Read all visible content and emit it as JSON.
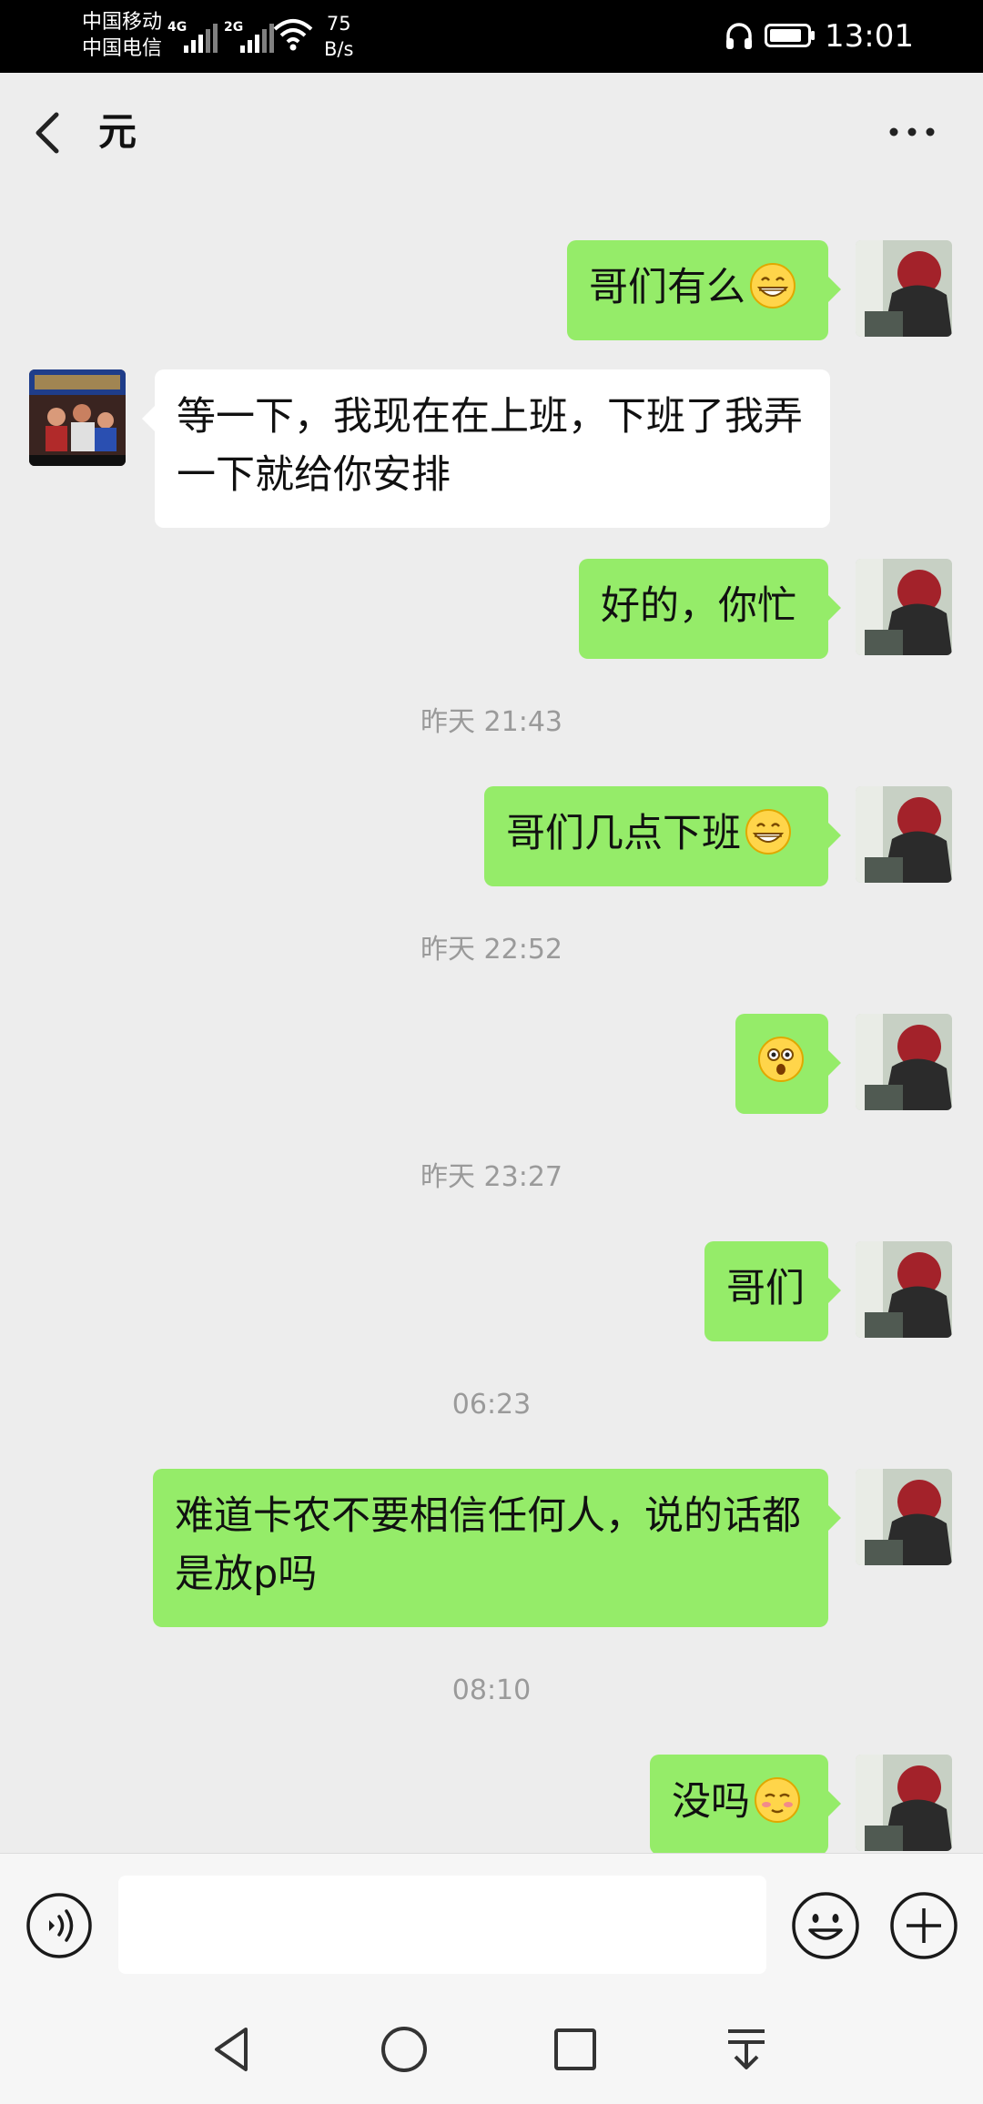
{
  "status_bar": {
    "carrier_1": "中国移动",
    "carrier_2": "中国电信",
    "network_1": "4G",
    "network_2": "2G",
    "speed_value": "75",
    "speed_unit": "B/s",
    "time": "13:01",
    "icons": [
      "signal-icon",
      "wifi-icon",
      "headphone-icon",
      "battery-icon"
    ]
  },
  "header": {
    "title": "元",
    "back_icon": "chevron-left-icon",
    "more_icon": "more-dots-icon"
  },
  "messages": [
    {
      "side": "right",
      "text": "哥们有么",
      "emoji": "grin"
    },
    {
      "side": "left",
      "text": "等一下，我现在在上班，下班了我弄一下就给你安排"
    },
    {
      "side": "right",
      "text": "好的，你忙"
    },
    {
      "timestamp": "昨天 21:43"
    },
    {
      "side": "right",
      "text": "哥们几点下班",
      "emoji": "grin"
    },
    {
      "timestamp": "昨天 22:52"
    },
    {
      "side": "right",
      "text": "",
      "emoji": "surprised"
    },
    {
      "timestamp": "昨天 23:27"
    },
    {
      "side": "right",
      "text": "哥们"
    },
    {
      "timestamp": "06:23"
    },
    {
      "side": "right",
      "text": "难道卡农不要相信任何人，说的话都是放p吗"
    },
    {
      "timestamp": "08:10"
    },
    {
      "side": "right",
      "text": "没吗",
      "emoji": "blush"
    }
  ],
  "input_bar": {
    "value": "",
    "placeholder": "",
    "voice_icon": "voice-icon",
    "emoji_icon": "smiley-icon",
    "plus_icon": "plus-circle-icon"
  },
  "nav_bar": {
    "icons": [
      "back-triangle-icon",
      "home-circle-icon",
      "recents-square-icon",
      "notification-pull-icon"
    ]
  },
  "colors": {
    "bubble_self": "#95ec69",
    "bubble_other": "#ffffff",
    "chat_background": "#ededed",
    "timestamp_text": "#9a9a9a"
  }
}
